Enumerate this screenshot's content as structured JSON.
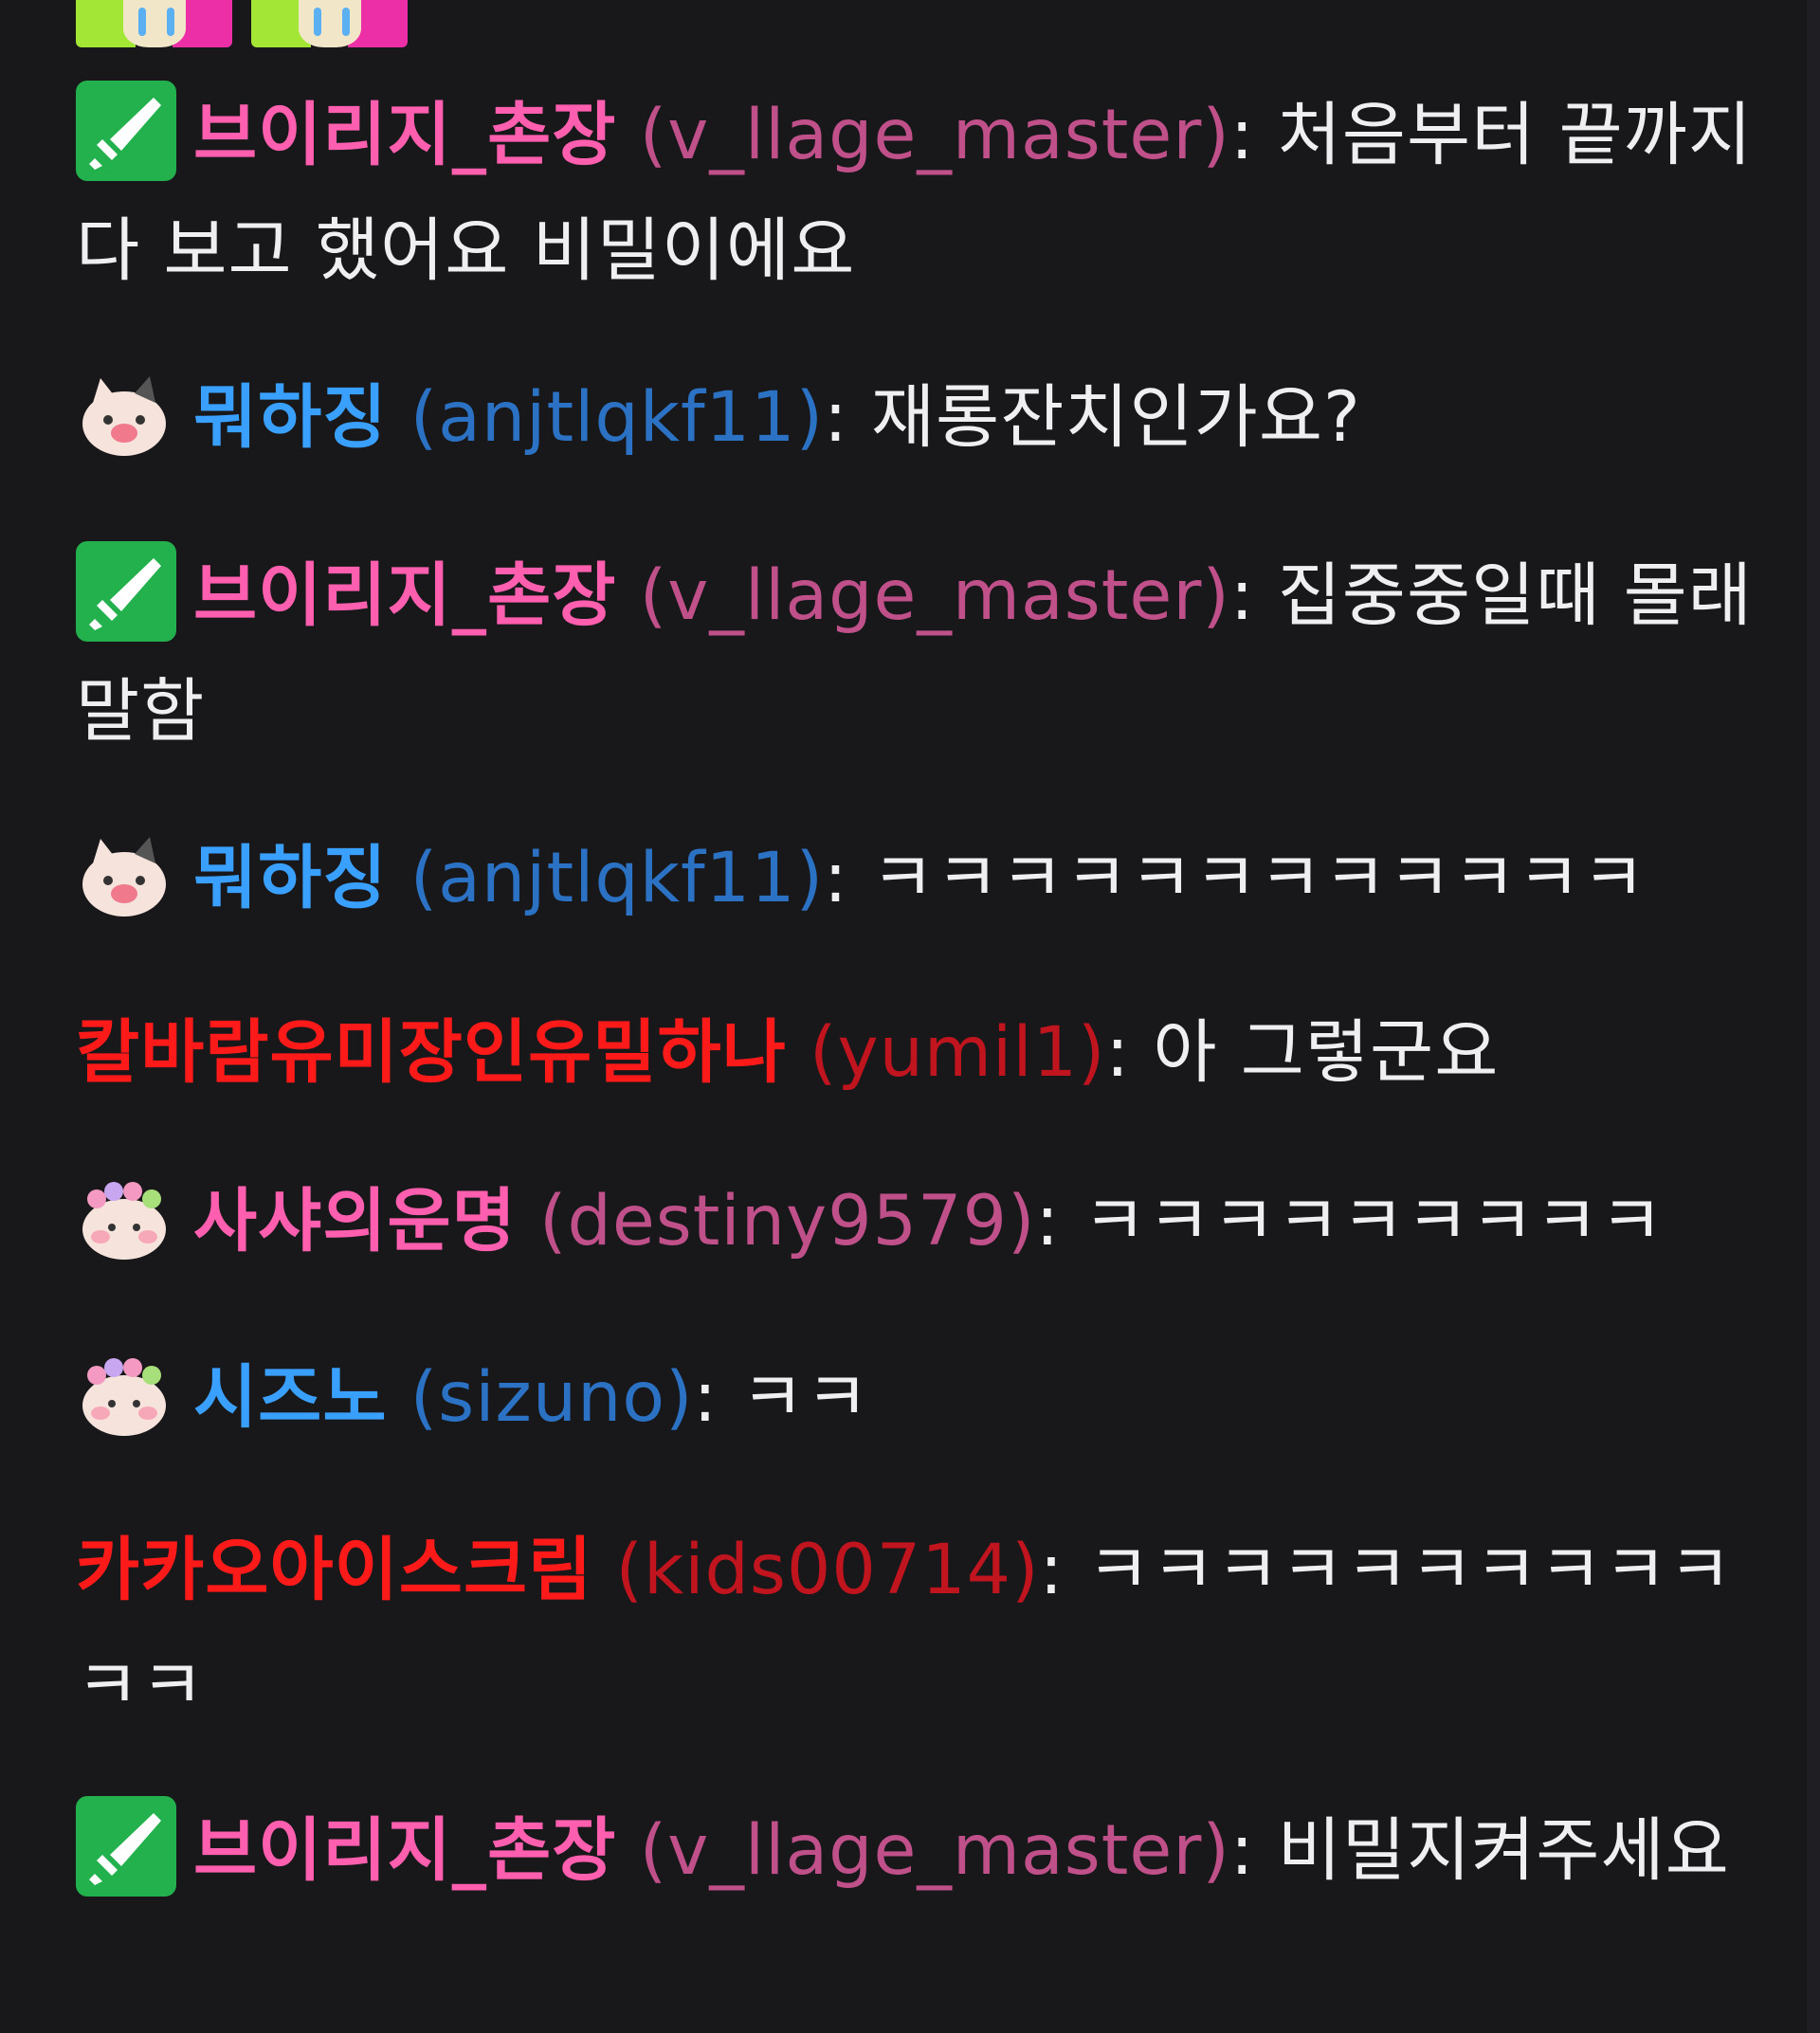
{
  "colors": {
    "background": "#18181b",
    "text": "#efeff1",
    "pink_name": "#ff5fae",
    "pink_login": "#c0508a",
    "blue_name": "#3aa0ff",
    "blue_login": "#2b72c4",
    "red_name": "#ff1a1a",
    "red_login": "#c0141e",
    "badge_green": "#22b14c"
  },
  "top_emotes": [
    {
      "icon": "crying-face-emote"
    },
    {
      "icon": "crying-face-emote"
    }
  ],
  "messages": [
    {
      "badge": "sword-badge-icon",
      "name": "브이리지_촌장",
      "login": "(v_llage_master)",
      "text": "처음부터 끝까지 다 보고 했어요 비밀이에요",
      "color": "pink"
    },
    {
      "badge": "cat-avatar-icon",
      "name": "뭐하징",
      "login": "(anjtlqkf11)",
      "text": "재롱잔치인가요?",
      "color": "blue"
    },
    {
      "badge": "sword-badge-icon",
      "name": "브이리지_촌장",
      "login": "(v_llage_master)",
      "text": "집중중일때 몰래 말함",
      "color": "pink"
    },
    {
      "badge": "cat-avatar-icon",
      "name": "뭐하징",
      "login": "(anjtlqkf11)",
      "text": "ㅋㅋㅋㅋㅋㅋㅋㅋㅋㅋㅋㅋ",
      "color": "blue"
    },
    {
      "badge": "",
      "name": "칼바람유미장인유밀하나",
      "login": "(yumil1)",
      "text": "아 그렇군요",
      "color": "red"
    },
    {
      "badge": "flower-cat-avatar-icon",
      "name": "사샤의운명",
      "login": "(destiny9579)",
      "text": "ㅋㅋㅋㅋㅋㅋㅋㅋㅋ",
      "color": "pink"
    },
    {
      "badge": "flower-cat-avatar-icon",
      "name": "시즈노",
      "login": "(sizuno)",
      "text": "ㅋㅋ",
      "color": "blue"
    },
    {
      "badge": "",
      "name": "카카오아이스크림",
      "login": "(kids00714)",
      "text": "ㅋㅋㅋㅋㅋㅋㅋㅋㅋㅋㅋㅋ",
      "color": "red"
    },
    {
      "badge": "sword-badge-icon",
      "name": "브이리지_촌장",
      "login": "(v_llage_master)",
      "text": "비밀지켜주세요",
      "color": "pink"
    }
  ]
}
